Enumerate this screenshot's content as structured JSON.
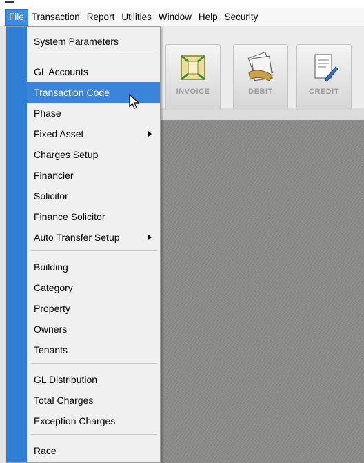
{
  "menubar": {
    "items": [
      "File",
      "Transaction",
      "Report",
      "Utilities",
      "Window",
      "Help",
      "Security"
    ]
  },
  "toolbar": {
    "buttons": [
      {
        "label": "INVOICE",
        "icon": "invoice-icon"
      },
      {
        "label": "DEBIT",
        "icon": "debit-icon"
      },
      {
        "label": "CREDIT",
        "icon": "credit-icon"
      }
    ]
  },
  "file_menu": {
    "items": [
      {
        "label": "System Parameters"
      },
      {
        "label": "GL Accounts"
      },
      {
        "label": "Transaction Code",
        "highlighted": true
      },
      {
        "label": "Phase"
      },
      {
        "label": "Fixed Asset",
        "submenu": true
      },
      {
        "label": "Charges Setup"
      },
      {
        "label": "Financier"
      },
      {
        "label": "Solicitor"
      },
      {
        "label": "Finance Solicitor"
      },
      {
        "label": "Auto Transfer Setup",
        "submenu": true
      },
      {
        "label": "Building"
      },
      {
        "label": "Category"
      },
      {
        "label": "Property"
      },
      {
        "label": "Owners"
      },
      {
        "label": "Tenants"
      },
      {
        "label": "GL Distribution"
      },
      {
        "label": "Total Charges"
      },
      {
        "label": "Exception Charges"
      },
      {
        "label": "Race"
      }
    ]
  },
  "colors": {
    "menu_gutter": "#2f7fd6",
    "highlight": "#3a84db",
    "desktop": "#8b8b89"
  }
}
